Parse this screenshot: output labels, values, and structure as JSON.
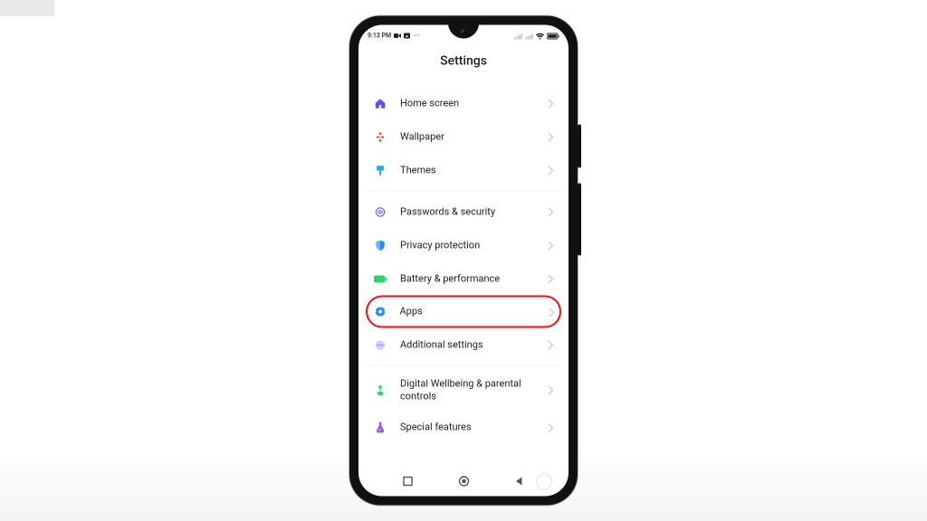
{
  "statusbar": {
    "time": "9:13 PM"
  },
  "title": "Settings",
  "groups": [
    {
      "items": [
        {
          "key": "home-screen",
          "label": "Home screen",
          "iconColor": "#6a4cff"
        },
        {
          "key": "wallpaper",
          "label": "Wallpaper",
          "iconColor": "#e0436b"
        },
        {
          "key": "themes",
          "label": "Themes",
          "iconColor": "#2aa7ff"
        }
      ]
    },
    {
      "items": [
        {
          "key": "passwords-security",
          "label": "Passwords & security",
          "iconColor": "#6a4cff"
        },
        {
          "key": "privacy-protection",
          "label": "Privacy protection",
          "iconColor": "#1f8fff"
        },
        {
          "key": "battery-performance",
          "label": "Battery & performance",
          "iconColor": "#2bd46a"
        },
        {
          "key": "apps",
          "label": "Apps",
          "iconColor": "#1f8fff",
          "highlight": true
        },
        {
          "key": "additional-settings",
          "label": "Additional settings",
          "iconColor": "#8a7bff"
        }
      ]
    },
    {
      "items": [
        {
          "key": "digital-wellbeing",
          "label": "Digital Wellbeing & parental controls",
          "iconColor": "#2bd46a"
        },
        {
          "key": "special-features",
          "label": "Special features",
          "iconColor": "#8a5bff"
        }
      ]
    }
  ]
}
